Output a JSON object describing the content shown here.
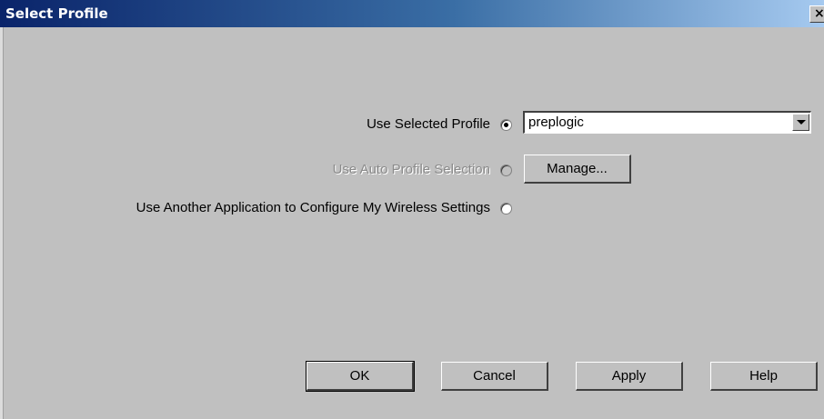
{
  "window": {
    "title": "Select Profile",
    "close_glyph": "×"
  },
  "options": {
    "use_selected_profile": {
      "label": "Use Selected Profile",
      "selected": true
    },
    "use_auto_profile_selection": {
      "label": "Use Auto Profile Selection",
      "selected": false,
      "disabled": true
    },
    "use_another_application": {
      "label": "Use Another Application to Configure My Wireless Settings",
      "selected": false
    }
  },
  "profile_dropdown": {
    "value": "preplogic"
  },
  "buttons": {
    "manage": "Manage...",
    "ok": "OK",
    "cancel": "Cancel",
    "apply": "Apply",
    "help": "Help"
  },
  "colors": {
    "title_bar_start": "#0a246a",
    "title_bar_end": "#a6caf0",
    "dialog_face": "#c0c0c0",
    "disabled_text": "#8a8a8a"
  }
}
